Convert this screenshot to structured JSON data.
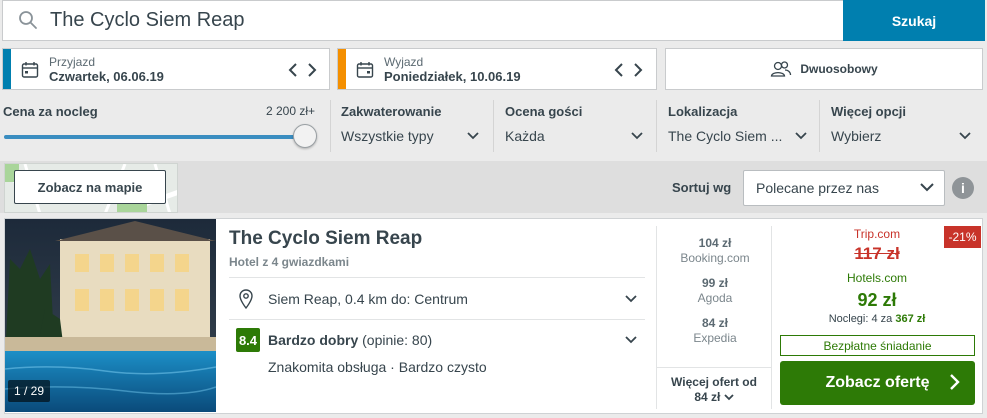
{
  "search": {
    "query": "The Cyclo Siem Reap",
    "button_label": "Szukaj"
  },
  "dates": {
    "checkin": {
      "label": "Przyjazd",
      "value": "Czwartek, 06.06.19",
      "accent": "#007faf"
    },
    "checkout": {
      "label": "Wyjazd",
      "value": "Poniedziałek, 10.06.19",
      "accent": "#f48f00"
    }
  },
  "room": {
    "label": "Dwuosobowy"
  },
  "filters": {
    "price": {
      "title": "Cena za nocleg",
      "max_label": "2 200 zł+"
    },
    "accommodation": {
      "title": "Zakwaterowanie",
      "value": "Wszystkie typy"
    },
    "rating": {
      "title": "Ocena gości",
      "value": "Każda"
    },
    "location": {
      "title": "Lokalizacja",
      "value": "The Cyclo Siem ..."
    },
    "more": {
      "title": "Więcej opcji",
      "value": "Wybierz"
    }
  },
  "toolbar": {
    "map_button": "Zobacz na mapie",
    "sort_label": "Sortuj wg",
    "sort_value": "Polecane przez nas",
    "info_icon": "i"
  },
  "hotel": {
    "name": "The Cyclo Siem Reap",
    "type": "Hotel z 4 gwiazdkami",
    "photo_counter": "1 / 29",
    "location": "Siem Reap, 0.4 km do: Centrum",
    "rating_score": "8.4",
    "rating_label": "Bardzo dobry",
    "rating_count": "(opinie: 80)",
    "highlights": "Znakomita obsługa · Bardzo czysto"
  },
  "other_deals": [
    {
      "price": "104 zł",
      "site": "Booking.com"
    },
    {
      "price": "99 zł",
      "site": "Agoda"
    },
    {
      "price": "84 zł",
      "site": "Expedia"
    }
  ],
  "more_deals": {
    "label": "Więcej ofert od",
    "price": "84 zł"
  },
  "best_deal": {
    "discount": "-21%",
    "old_site": "Trip.com",
    "old_price": "117 zł",
    "site": "Hotels.com",
    "price": "92 zł",
    "nights_prefix": "Noclegi: 4 za",
    "nights_total": "367 zł",
    "perk": "Bezpłatne śniadanie",
    "button_label": "Zobacz ofertę"
  },
  "colors": {
    "accent_blue": "#007faf",
    "deal_green": "#2d7a06",
    "discount_red": "#c8332a"
  }
}
